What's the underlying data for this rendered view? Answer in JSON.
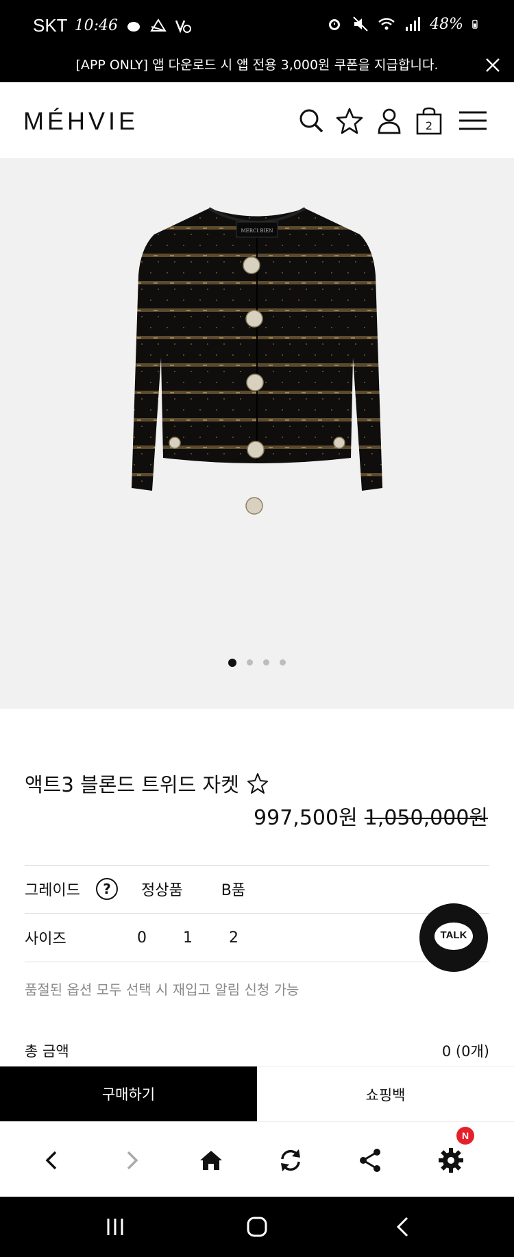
{
  "status_bar": {
    "carrier": "SKT",
    "time": "10:46",
    "battery": "48%"
  },
  "promo": {
    "text": "[APP ONLY] 앱 다운로드 시 앱 전용 3,000원 쿠폰을 지급합니다."
  },
  "header": {
    "logo": "MÉHVIE",
    "cart_count": "2"
  },
  "gallery": {
    "label_on_garment": "MERCI BIEN",
    "slides": 4,
    "active_slide": 1
  },
  "product": {
    "title": "액트3 블론드 트위드 자켓",
    "sale_price": "997,500원",
    "original_price": "1,050,000원"
  },
  "options": {
    "grade_label": "그레이드",
    "grade_help": "?",
    "grade_values": [
      "정상품",
      "B품"
    ],
    "size_label": "사이즈",
    "size_values": [
      "0",
      "1",
      "2"
    ]
  },
  "notice": "품절된 옵션 모두 선택 시 재입고 알림 신청 가능",
  "talk": {
    "label": "TALK"
  },
  "total": {
    "label": "총 금액",
    "value": "0 (0개)"
  },
  "actions": {
    "buy": "구매하기",
    "bag": "쇼핑백"
  },
  "toolbar": {
    "badge": "N"
  },
  "colors": {
    "black": "#000000",
    "notice_gray": "#8a8a8a",
    "badge_red": "#e5202a",
    "hero_bg": "#f1f1f1"
  }
}
